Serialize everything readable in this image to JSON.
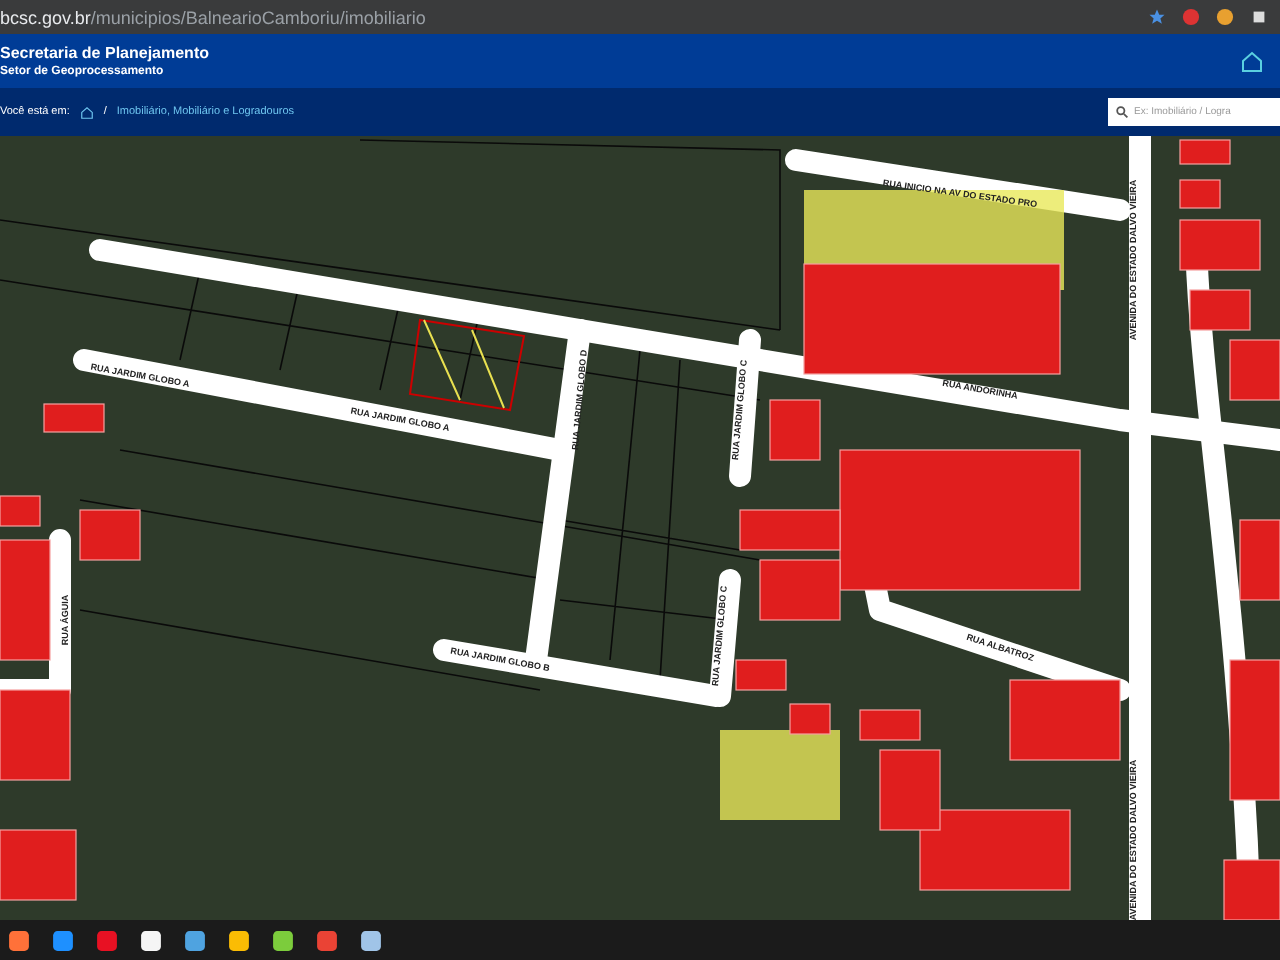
{
  "browser": {
    "domain": "bcsc.gov.br",
    "path": "/municipios/BalnearioCamboriu/imobiliario"
  },
  "header": {
    "title": "Secretaria de Planejamento",
    "subtitle": "Setor de Geoprocessamento"
  },
  "breadcrumb": {
    "label": "Você está em:",
    "separator": "/",
    "items": [
      "Imobiliário, Mobiliário e Logradouros"
    ]
  },
  "search": {
    "placeholder": "Ex: Imobiliário / Logra"
  },
  "map": {
    "streets": [
      {
        "name": "RUA INICIO NA AV DO ESTADO PRO"
      },
      {
        "name": "RUA JARDIM GLOBO A"
      },
      {
        "name": "RUA JARDIM GLOBO A"
      },
      {
        "name": "RUA JARDIM GLOBO D"
      },
      {
        "name": "RUA JARDIM GLOBO C"
      },
      {
        "name": "RUA JARDIM GLOBO C"
      },
      {
        "name": "RUA JARDIM GLOBO B"
      },
      {
        "name": "RUA ANDORINHA"
      },
      {
        "name": "RUA ALBATROZ"
      },
      {
        "name": "RUA ÁGUIA"
      },
      {
        "name": "AVENIDA DO ESTADO DALVO VIEIRA"
      },
      {
        "name": "AVENIDA DO ESTADO DALVO VIEIRA"
      }
    ]
  }
}
